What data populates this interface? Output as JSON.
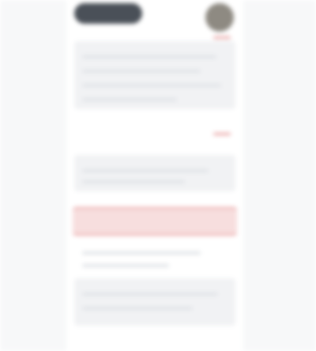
{
  "header": {
    "title": "",
    "subtitle": ""
  },
  "sections": [
    {
      "label": ""
    },
    {
      "label": ""
    },
    {
      "label": ""
    }
  ],
  "alert": {
    "text": ""
  },
  "colors": {
    "page_background": "#ffffff",
    "side_background": "#f7f8f9",
    "panel_background": "#f1f2f4",
    "logo": "#4a5058",
    "avatar": "#8e8a82",
    "accent": "#e8a2a2",
    "alert_background": "#f7dede"
  }
}
